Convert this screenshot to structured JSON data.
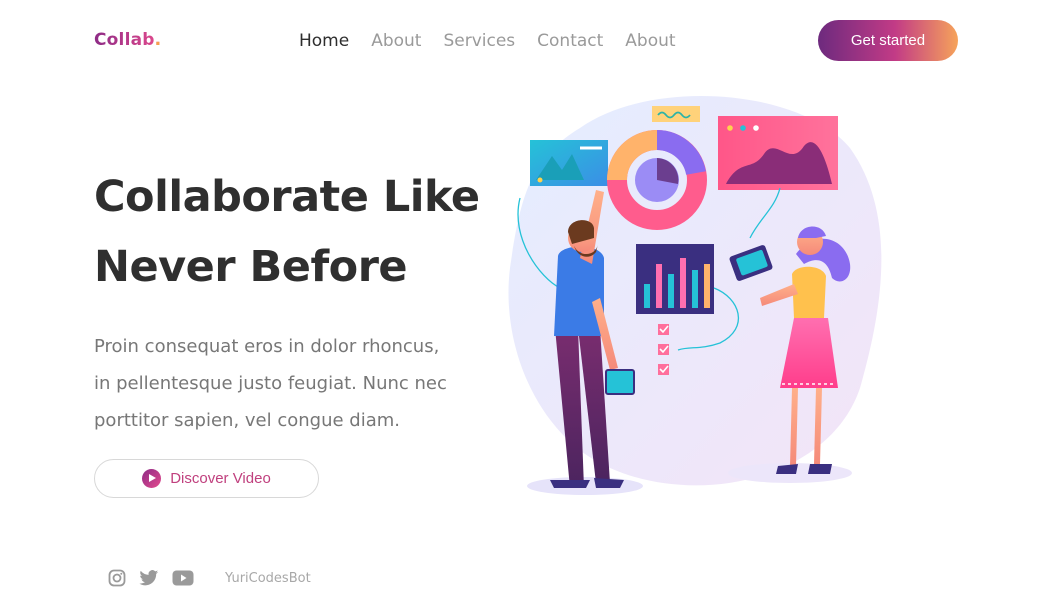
{
  "brand": {
    "name": "Collab",
    "dot": "."
  },
  "nav": {
    "items": [
      {
        "label": "Home",
        "active": true
      },
      {
        "label": "About",
        "active": false
      },
      {
        "label": "Services",
        "active": false
      },
      {
        "label": "Contact",
        "active": false
      },
      {
        "label": "About",
        "active": false
      }
    ]
  },
  "header": {
    "cta_label": "Get started"
  },
  "hero": {
    "title_line1": "Collaborate Like",
    "title_line2": "Never Before",
    "description_line1": "Proin consequat eros in dolor rhoncus,",
    "description_line2": "in pellentesque justo feugiat. Nunc nec",
    "description_line3": "porttitor sapien, vel congue diam.",
    "video_label": "Discover Video"
  },
  "footer": {
    "social_icons": [
      "instagram-icon",
      "twitter-icon",
      "youtube-icon"
    ],
    "credit": "YuriCodesBot"
  },
  "colors": {
    "brand_start": "#8d2b86",
    "brand_end": "#e44a8d",
    "accent_orange": "#f6a35a",
    "nav_inactive": "#9a9a9a"
  }
}
